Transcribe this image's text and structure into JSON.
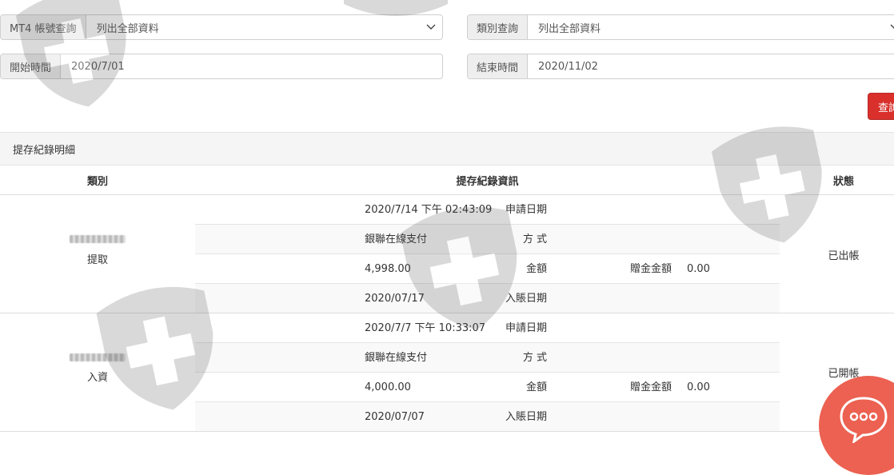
{
  "filters": {
    "account": {
      "label": "MT4 帳號查詢",
      "value": "列出全部資料"
    },
    "category": {
      "label": "類別查詢",
      "value": "列出全部資料"
    },
    "start": {
      "label": "開始時間",
      "value": "2020/7/01"
    },
    "end": {
      "label": "結束時間",
      "value": "2020/11/02"
    }
  },
  "query_button": "查詢",
  "panel": {
    "title": "提存紀錄明細"
  },
  "table": {
    "headers": {
      "category": "類別",
      "info": "提存紀錄資訊",
      "status": "狀態"
    },
    "field_labels": {
      "apply_date": "申請日期",
      "method": "方 式",
      "amount": "金額",
      "bonus": "贈金金額",
      "post_date": "入賬日期"
    },
    "records": [
      {
        "type": "提取",
        "apply_date": "2020/7/14 下午 02:43:09",
        "method": "銀聯在線支付",
        "amount": "4,998.00",
        "bonus": "0.00",
        "post_date": "2020/07/17",
        "status": "已出帳"
      },
      {
        "type": "入資",
        "apply_date": "2020/7/7 下午 10:33:07",
        "method": "銀聯在線支付",
        "amount": "4,000.00",
        "bonus": "0.00",
        "post_date": "2020/07/07",
        "status": "已開帳"
      }
    ]
  },
  "icons": {
    "dropdown": "chevron-down-icon",
    "watermark": "shield-cross-icon",
    "chat": "chat-bubble-icon"
  },
  "colors": {
    "query_button": "#d9302c",
    "chat_button": "#ec6151",
    "stripe": "#f9f9f9"
  }
}
